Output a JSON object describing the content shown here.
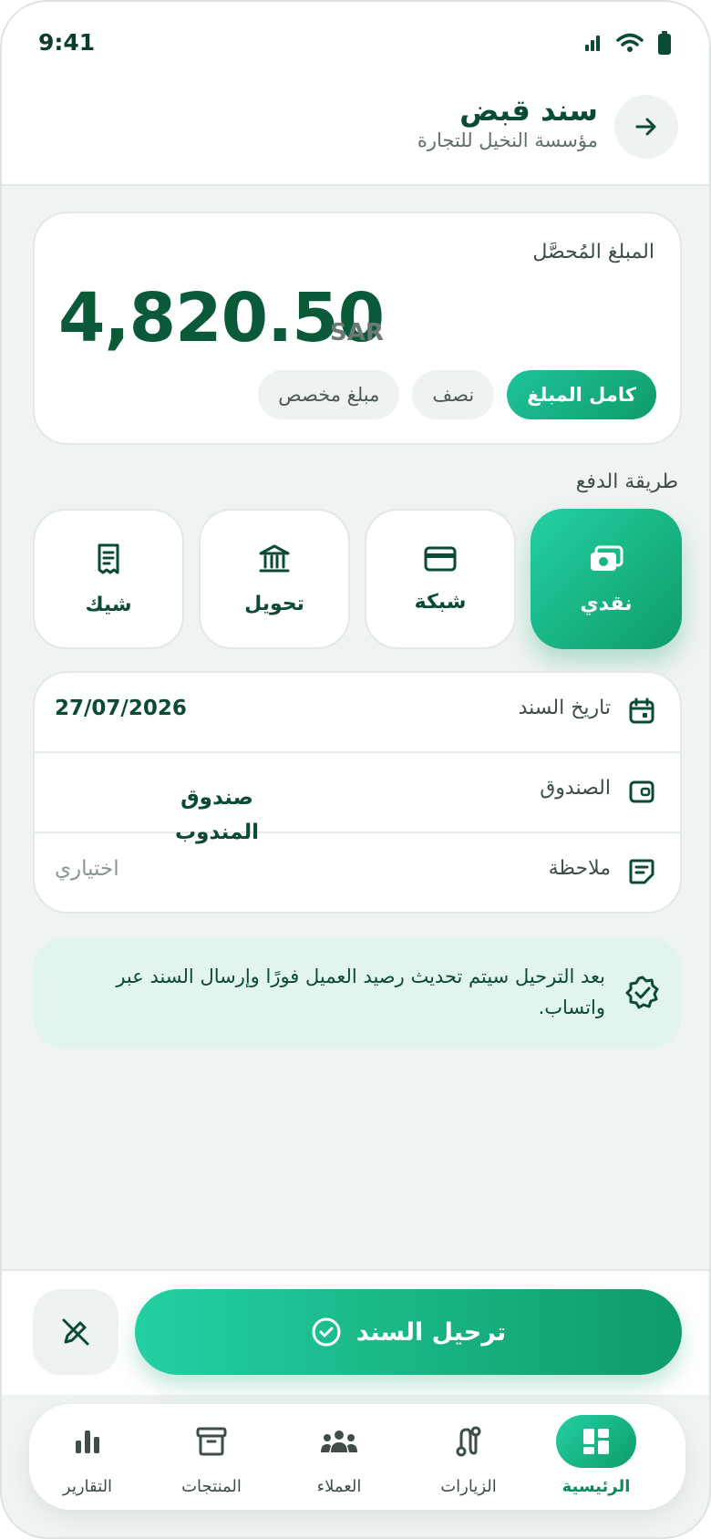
{
  "status": {
    "time": "9:41"
  },
  "header": {
    "title": "سند قبض",
    "subtitle": "مؤسسة النخيل للتجارة"
  },
  "amount": {
    "label": "المبلغ المُحصَّل",
    "value": "4,820.50",
    "currency": "SAR",
    "options": [
      {
        "label": "كامل المبلغ",
        "active": true
      },
      {
        "label": "نصف",
        "active": false
      },
      {
        "label": "مبلغ مخصص",
        "active": false
      }
    ]
  },
  "payment": {
    "label": "طريقة الدفع",
    "methods": [
      {
        "label": "نقدي",
        "icon": "cash-icon",
        "active": true
      },
      {
        "label": "شبكة",
        "icon": "card-icon",
        "active": false
      },
      {
        "label": "تحويل",
        "icon": "bank-icon",
        "active": false
      },
      {
        "label": "شيك",
        "icon": "receipt-icon",
        "active": false
      }
    ]
  },
  "details": {
    "date_label": "تاريخ السند",
    "date_value": "27/07/2026",
    "box_label": "الصندوق",
    "box_value_line1": "صندوق",
    "box_value_line2": "المندوب",
    "note_label": "ملاحظة",
    "note_placeholder": "اختياري"
  },
  "info": {
    "text": "بعد الترحيل سيتم تحديث رصيد العميل فورًا وإرسال السند عبر واتساب."
  },
  "actions": {
    "submit_label": "ترحيل السند"
  },
  "nav": [
    {
      "label": "الرئيسية",
      "icon": "dashboard-icon",
      "active": true
    },
    {
      "label": "الزيارات",
      "icon": "route-icon",
      "active": false
    },
    {
      "label": "العملاء",
      "icon": "users-icon",
      "active": false
    },
    {
      "label": "المنتجات",
      "icon": "box-icon",
      "active": false
    },
    {
      "label": "التقارير",
      "icon": "chart-icon",
      "active": false
    }
  ],
  "colors": {
    "accent": "#12b07d",
    "dark_green": "#0b4a33",
    "background": "#eff3f2"
  }
}
